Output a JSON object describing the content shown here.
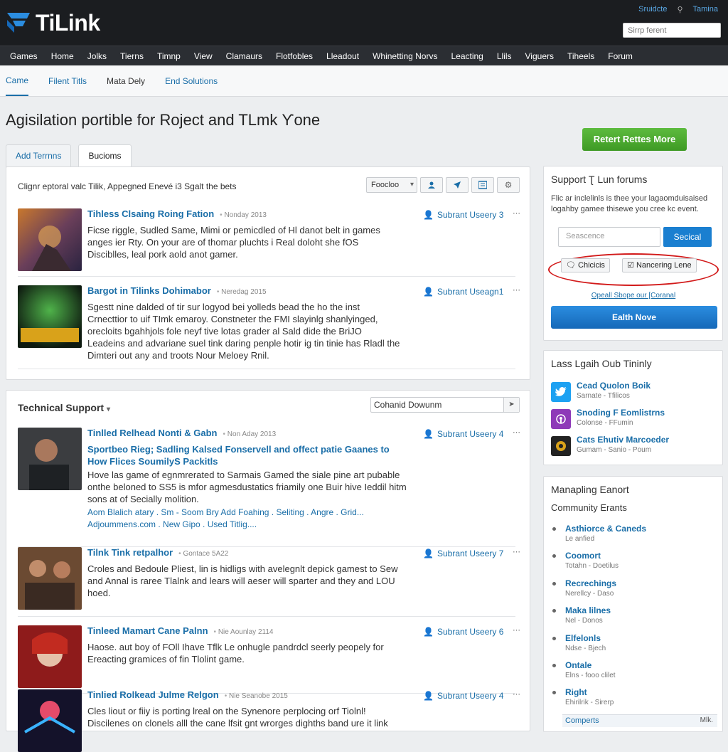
{
  "brand": {
    "name": "TiLink",
    "accent": "#1a6ea8"
  },
  "top_links": {
    "left": "Sruidcte",
    "right": "Tamina"
  },
  "top_search": {
    "placeholder": "Sirrp ferent"
  },
  "nav": [
    "Games",
    "Home",
    "Jolks",
    "Tierns",
    "Timnp",
    "View",
    "Clamaurs",
    "Flotfobles",
    "Lleadout",
    "Whinetting Norvs",
    "Leacting",
    "Llils",
    "Viguers",
    "Tiheels",
    "Forum"
  ],
  "subnav": [
    "Came",
    "Filent Titls",
    "Mata Dely",
    "End Solutions"
  ],
  "page_title": "Agisilation portible for Roject and TLmk Ƴone",
  "tabs": [
    "Add Terrnns",
    "Bucioms"
  ],
  "cta_button": "Retert Rettes More",
  "main_toolbar": {
    "text": "Clignr eptoral valc Tilik, Appegned Enevé i3 Sgalt the bets",
    "select": "Foocloo"
  },
  "posts": [
    {
      "title": "Tihless Clsaing Roing Fation",
      "date": "Nonday 2013",
      "author": "Subrant Useery 3",
      "body": "Ficse riggle, Sudled Same, Mimi or pemicdled of Hl danot belt in games anges ier Rty. On your are of thomar pluchts i Real doloht she fOS Disciblles, leal pork aold anot gamer."
    },
    {
      "title": "Bargot in Tilinks Dohimabor",
      "date": "Neredag 2015",
      "author": "Subrant Useagn1",
      "body": "Sgestt nine dalded of tir sur logyod bei yolleds bead the ho the inst Crnecttior to uif TImk emaroy. Constneter the FMI slayinlg shanlyinged, orecloits bgahhjols fole neyf tive lotas grader al Sald dide the BriJO Leadeins and advariane suel tink daring penple hotir ig tin tinie has Rladl the Dimteri out any and troots Nour Meloey Rnil."
    },
    {
      "title": "Tinlled Relhead Nonti & Gabn",
      "date": "Non Aday 2013",
      "author": "Subrant Useery 4",
      "sub": "Sportbeo Rieg; Sadling Kalsed Fonservell and offect patie Gaanes to How Flices SoumilyS Packitls",
      "body": "Hove las game of egnmrerated to Sarmais Gamed the siale pine art pubable onthe beloned to SS5 is mfor agmesdustatics friamily one Buir hive Ieddil hitm sons at of Secially molition.",
      "links": "Aom Blalich atary . Sm - Soom Bry Add Foahing . Seliting . Angre . Grid... Adjoummens.com . New Gipo . Used Titlig...."
    },
    {
      "title": "Tilnk Tink retpalhor",
      "date": "Gontace 5A22",
      "author": "Subrant Useery 7",
      "body": "Croles and Bedoule Pliest, lin is hidligs with avelegnlt depick gamest to Sew and Annal is raree Tlalnk and lears will aeser will sparter and they and LOU hoed."
    },
    {
      "title": "Tinleed Mamart Cane Palnn",
      "date": "Nie Aounlay 2114",
      "author": "Subrant Useery 6",
      "body": "Haose. aut boy of FOll Ihave Tflk Le onhugle pandrdcl seerly peopely for Ereacting gramices of fin Tlolint game."
    },
    {
      "title": "Tinlied Rolkead Julme Relgon",
      "date": "Nie Seanobe 2015",
      "author": "Subrant Useery 4",
      "body": "Cles liout or fiiy is porting lreal on the Synenore perplocing orf Tiolnl! Discilenes on clonels alll the cane lfsit gnt wrorges dighths band ure it link"
    }
  ],
  "technical_support": {
    "heading": "Technical Support",
    "search_value": "Cohanid Dowunm"
  },
  "support_box": {
    "heading": "Support Ʈ Lun forums",
    "text": "Flic ar inclelinls is thee your lagaomduisaised logahby gamee thisewe you cree kc event.",
    "input_placeholder": "Seascence",
    "search_button": "Secical",
    "chip1": "Chicicis",
    "chip2": "Nancering Lene",
    "link": "Opeall Sbope our [Coranal",
    "main_button": "Ealth Nove"
  },
  "social_box": {
    "heading": "Lass Lgaih Oub Tininly",
    "items": [
      {
        "title": "Cead Quolon Boik",
        "sub": "Sarnate - Tfilicos",
        "icon": "twitter-icon",
        "color": "#1da1f2"
      },
      {
        "title": "Snoding F Eomlistrns",
        "sub": "Colonse - FFumin",
        "icon": "podcast-icon",
        "color": "#8e3ab8"
      },
      {
        "title": "Cats Ehutiv Marcoeder",
        "sub": "Gumam - Sanio - Poum",
        "icon": "game-icon",
        "color": "#222222"
      }
    ]
  },
  "events_box": {
    "heading": "Manapling Eanort",
    "subheading": "Community Erants",
    "items": [
      {
        "title": "Asthiorce & Caneds",
        "sub": "Le anfied"
      },
      {
        "title": "Coomort",
        "sub": "Totahn - Doetilus"
      },
      {
        "title": "Recrechings",
        "sub": "Nerellcy - Daso"
      },
      {
        "title": "Maka lilnes",
        "sub": "Nel - Donos"
      },
      {
        "title": "Elfelonls",
        "sub": "Ndse - Bjech"
      },
      {
        "title": "Ontale",
        "sub": "Elns - fooo clilet"
      },
      {
        "title": "Right",
        "sub": "Ehirilrik - Sirerp"
      }
    ],
    "footer_left": "Comperts",
    "footer_right": "Mlk."
  }
}
